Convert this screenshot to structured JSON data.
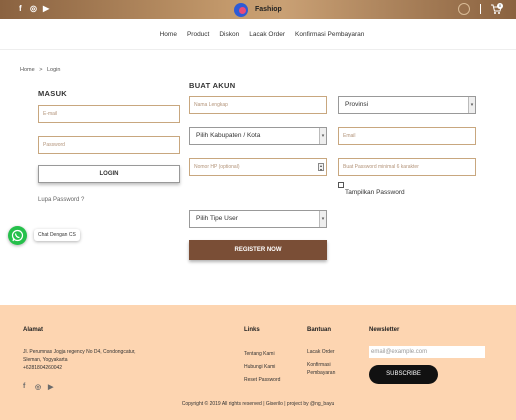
{
  "topbar": {
    "social": [
      "f",
      "◎",
      "▶"
    ],
    "brand": "Fashiop",
    "cart_count": "0"
  },
  "nav": {
    "items": [
      "Home",
      "Product",
      "Diskon",
      "Lacak Order",
      "Konfirmasi Pembayaran"
    ]
  },
  "breadcrumb": {
    "home": "Home",
    "sep": ">",
    "current": "Login"
  },
  "login": {
    "title": "MASUK",
    "email_placeholder": "E-mail",
    "password_placeholder": "Password",
    "button": "LOGIN",
    "forgot": "Lupa Password ?"
  },
  "register": {
    "title": "BUAT AKUN",
    "fullname_placeholder": "Nama Lengkap",
    "province": "Provinsi",
    "city": "Pilih Kabupaten / Kota",
    "email_placeholder": "Email",
    "phone_placeholder": "Nomor HP (optional)",
    "password_placeholder": "Buat Password minimal 6 karakter",
    "show_password": "Tampilkan Password",
    "user_type": "Pilih Tipe User",
    "button": "REGISTER NOW"
  },
  "chat": {
    "label": "Chat Dengan CS"
  },
  "footer": {
    "address_title": "Alamat",
    "address_lines": [
      "Jl. Perumnas Jogja regency No D4, Condongcatur,",
      "Sleman, Yogyakarta",
      "+6281804260042"
    ],
    "links_title": "Links",
    "links": [
      "Tentang Kami",
      "Hubungi Kami",
      "Reset Password"
    ],
    "help_title": "Bantuan",
    "help": [
      "Lacak Order",
      "Konfirmasi",
      "Pembayaran"
    ],
    "newsletter_title": "Newsletter",
    "newsletter_placeholder": "email@example.com",
    "subscribe": "SUBSCRIBE",
    "social": [
      "f",
      "◎",
      "▶"
    ],
    "copyright": "Copyright © 2019 All rights reserved | Giserilo | project by @ng_bayu"
  }
}
